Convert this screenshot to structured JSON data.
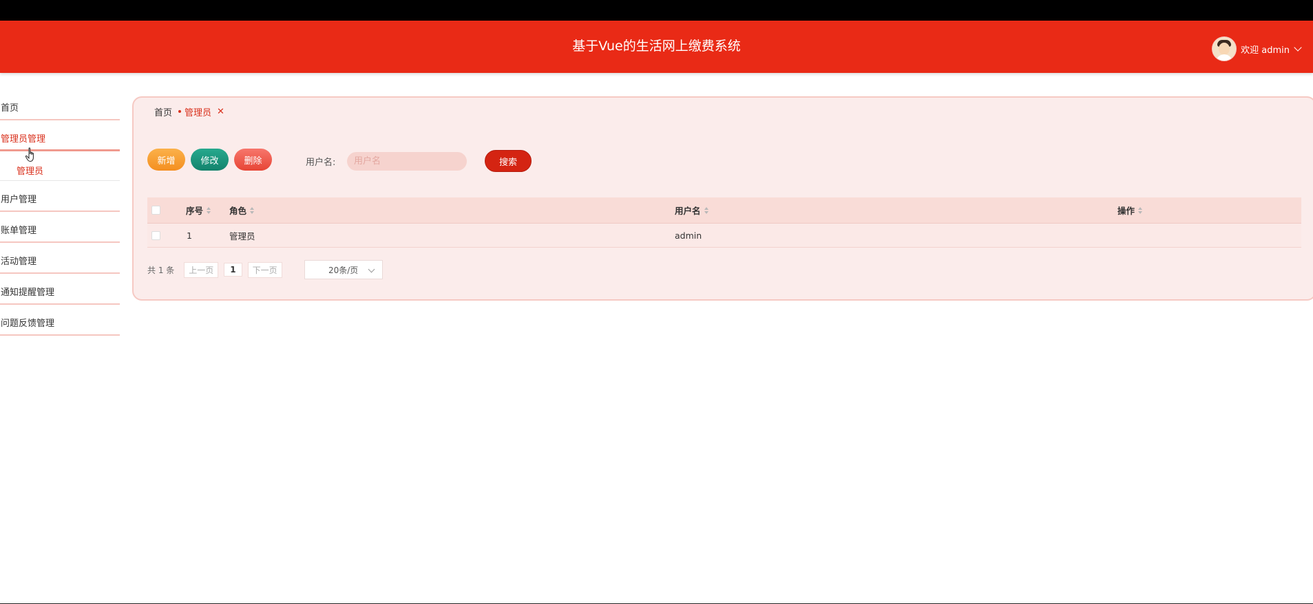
{
  "header": {
    "title": "基于Vue的生活网上缴费系统",
    "welcome": "欢迎 admin"
  },
  "sidebar": {
    "items": [
      {
        "label": "首页"
      },
      {
        "label": "管理员管理",
        "sub": [
          "管理员"
        ]
      },
      {
        "label": "用户管理"
      },
      {
        "label": "账单管理"
      },
      {
        "label": "活动管理"
      },
      {
        "label": "通知提醒管理"
      },
      {
        "label": "问题反馈管理"
      }
    ]
  },
  "tabs": [
    {
      "label": "首页"
    },
    {
      "label": "管理员"
    }
  ],
  "toolbar": {
    "add_label": "新增",
    "edit_label": "修改",
    "delete_label": "删除",
    "search_label": "用户名:",
    "search_placeholder": "用户名",
    "search_button": "搜索"
  },
  "table": {
    "columns": [
      "序号",
      "角色",
      "用户名",
      "操作"
    ],
    "rows": [
      {
        "index": "1",
        "role": "管理员",
        "username": "admin"
      }
    ]
  },
  "pagination": {
    "total": "共 1 条",
    "prev": "上一页",
    "page": "1",
    "next": "下一页",
    "page_size": "20条/页"
  }
}
